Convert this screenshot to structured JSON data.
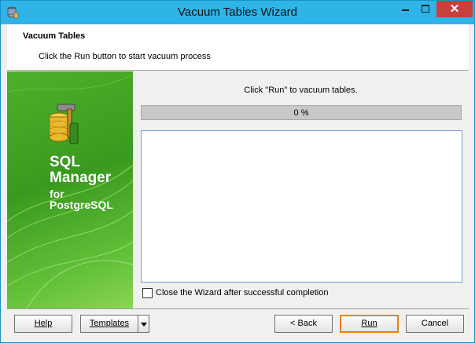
{
  "window": {
    "title": "Vacuum Tables Wizard",
    "close_glyph": "✕",
    "accent_color": "#2fb4e8",
    "close_color": "#c7413a"
  },
  "header": {
    "title": "Vacuum Tables",
    "subtitle": "Click the Run button to start vacuum process"
  },
  "banner": {
    "line1": "SQL",
    "line2": "Manager",
    "line3": "for",
    "line4": "PostgreSQL",
    "logo_icon": "database-hammer-icon",
    "color": "#4eb02a"
  },
  "content": {
    "status_message": "Click \"Run\" to vacuum tables.",
    "progress_text": "0 %",
    "progress_value": 0,
    "log_text": "",
    "close_checkbox_label": "Close the Wizard after successful completion",
    "close_checkbox_checked": false
  },
  "buttons": {
    "help": "Help",
    "templates": "Templates",
    "back": "< Back",
    "run": "Run",
    "cancel": "Cancel",
    "run_focus_color": "#f08000"
  }
}
